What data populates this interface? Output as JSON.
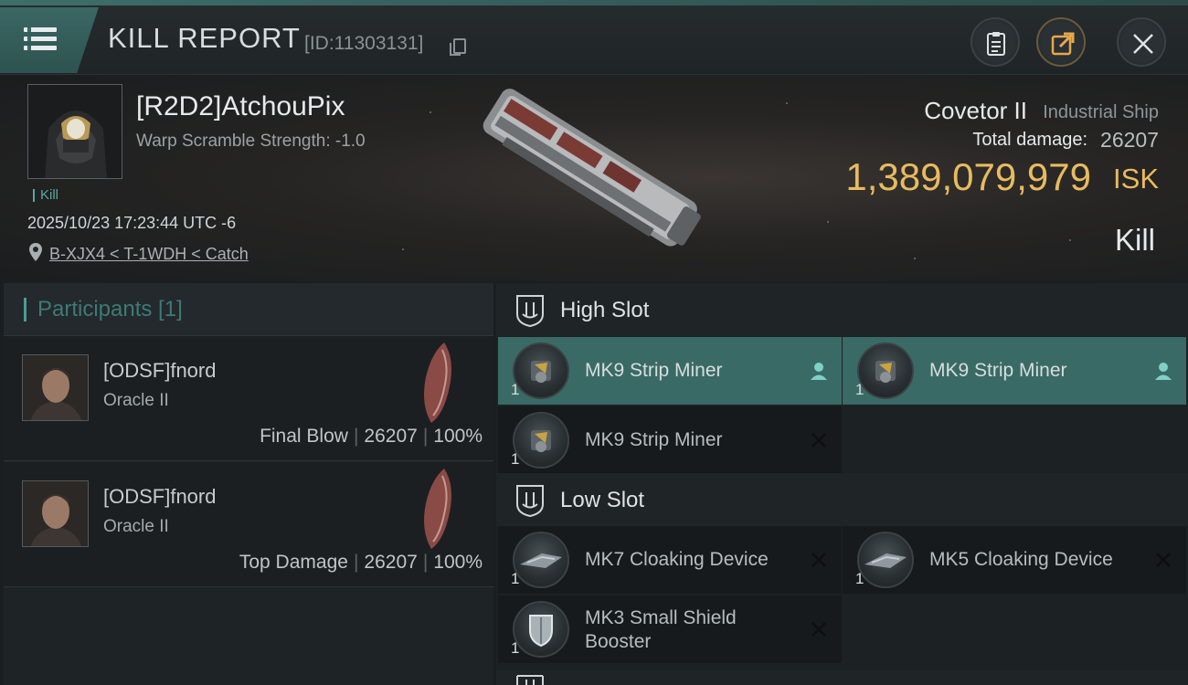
{
  "header": {
    "title": "KILL REPORT",
    "kill_id": "[ID:11303131]"
  },
  "victim": {
    "name": "[R2D2]AtchouPix",
    "warp_scramble": "Warp Scramble Strength: -1.0",
    "tag": "Kill",
    "timestamp": "2025/10/23 17:23:44 UTC -6",
    "location": "B-XJX4 < T-1WDH < Catch",
    "ship_name": "Covetor II",
    "ship_class": "Industrial Ship",
    "total_damage_label": "Total damage:",
    "total_damage": "26207",
    "isk_value": "1,389,079,979",
    "isk_unit": "ISK",
    "result": "Kill"
  },
  "participants": {
    "title": "Participants [1]",
    "rows": [
      {
        "name": "[ODSF]fnord",
        "ship": "Oracle II",
        "role": "Final Blow",
        "damage": "26207",
        "percent": "100%"
      },
      {
        "name": "[ODSF]fnord",
        "ship": "Oracle II",
        "role": "Top Damage",
        "damage": "26207",
        "percent": "100%"
      }
    ]
  },
  "fitting": {
    "high_slot": {
      "title": "High Slot",
      "modules": [
        {
          "name": "MK9 Strip Miner",
          "qty": "1",
          "status": "pilot-icon",
          "active": true
        },
        {
          "name": "MK9 Strip Miner",
          "qty": "1",
          "status": "pilot-icon",
          "active": true
        },
        {
          "name": "MK9 Strip Miner",
          "qty": "1",
          "status": "destroyed-x-icon",
          "active": false
        }
      ]
    },
    "low_slot": {
      "title": "Low Slot",
      "modules": [
        {
          "name": "MK7 Cloaking Device",
          "qty": "1",
          "status": "destroyed-x-icon",
          "active": false
        },
        {
          "name": "MK5 Cloaking Device",
          "qty": "1",
          "status": "destroyed-x-icon",
          "active": false
        },
        {
          "name": "MK3 Small Shield Booster",
          "qty": "1",
          "status": "destroyed-x-icon",
          "active": false
        }
      ]
    }
  },
  "colors": {
    "accent_teal": "#3a6a66",
    "isk_gold": "#e8bb5f"
  }
}
